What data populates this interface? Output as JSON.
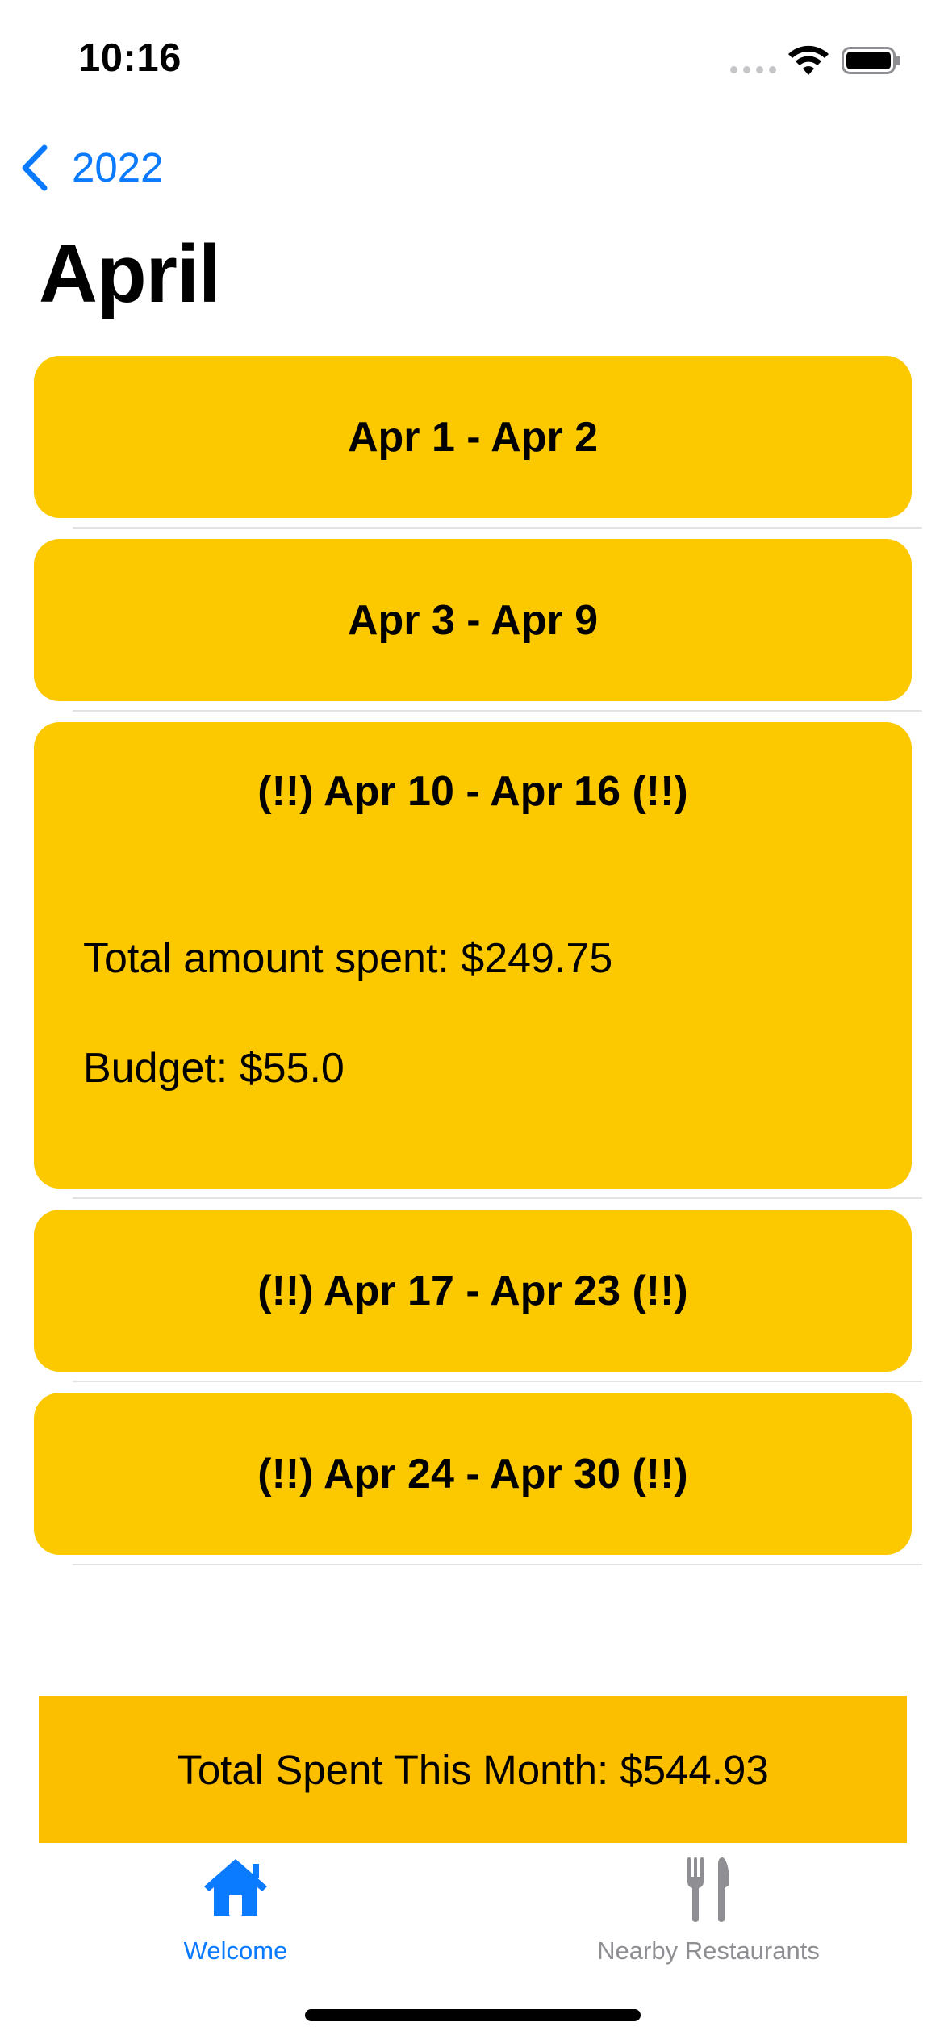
{
  "status_bar": {
    "time": "10:16"
  },
  "nav": {
    "back_label": "2022",
    "title": "April"
  },
  "weeks": [
    {
      "title": "Apr 1 - Apr 2",
      "flagged": false,
      "expanded": false
    },
    {
      "title": "Apr 3 - Apr 9",
      "flagged": false,
      "expanded": false
    },
    {
      "title": "(!!) Apr 10 - Apr 16 (!!)",
      "flagged": true,
      "expanded": true,
      "total_spent": "Total amount spent: $249.75",
      "budget": "Budget: $55.0"
    },
    {
      "title": "(!!) Apr 17 - Apr 23 (!!)",
      "flagged": true,
      "expanded": false
    },
    {
      "title": "(!!) Apr 24 - Apr 30 (!!)",
      "flagged": true,
      "expanded": false
    }
  ],
  "summary": {
    "total_label": "Total Spent This Month: $544.93"
  },
  "tab_bar": {
    "tabs": [
      {
        "label": "Welcome",
        "icon": "house-icon",
        "selected": true
      },
      {
        "label": "Nearby Restaurants",
        "icon": "fork-knife-icon",
        "selected": false
      }
    ]
  },
  "colors": {
    "accent": "#0a7aff",
    "card": "#fcc900",
    "total_bar": "#fcbf00",
    "inactive_tab": "#8e8e93"
  }
}
